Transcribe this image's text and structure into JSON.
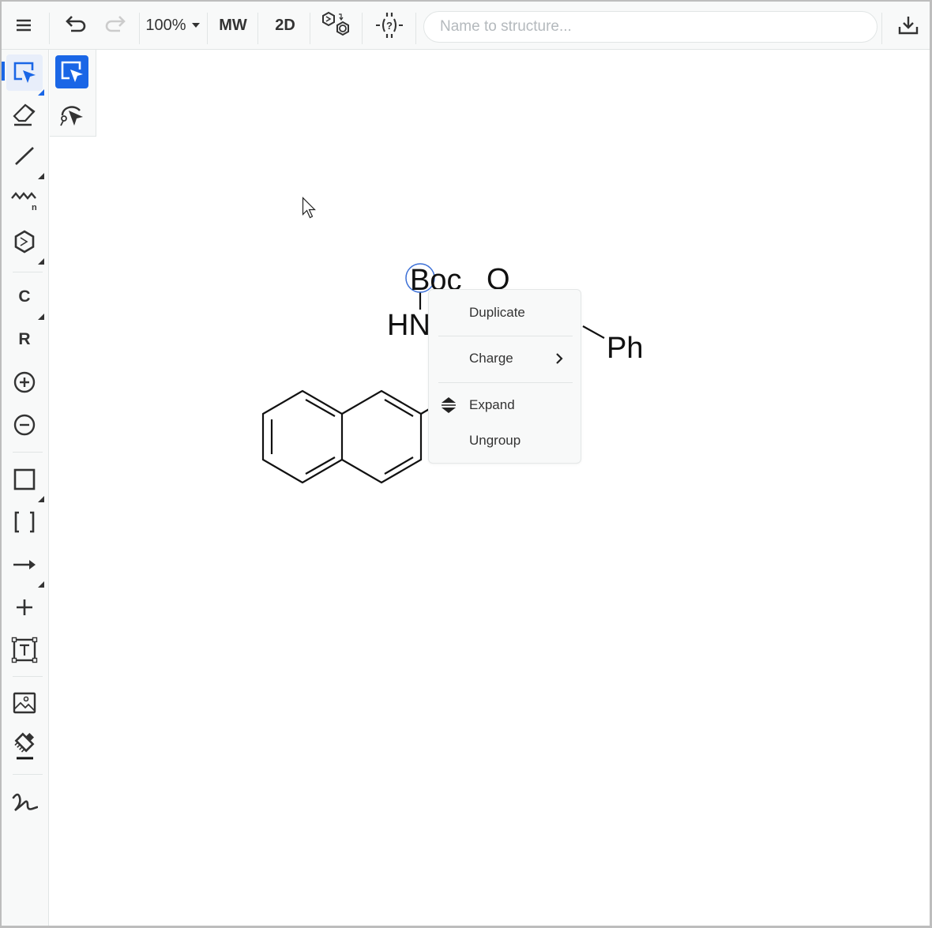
{
  "toolbar": {
    "menu_icon": "hamburger-menu-icon",
    "undo_icon": "undo-icon",
    "redo_icon": "redo-icon",
    "zoom_level": "100%",
    "mw_label": "MW",
    "dim_label": "2D",
    "aromatize_icon": "aromatize-icon",
    "query_icon": "query-features-icon",
    "search_placeholder": "Name to structure...",
    "search_value": "",
    "download_icon": "download-icon"
  },
  "left_tools": [
    {
      "name": "select",
      "icon": "selection-rectangle-icon",
      "active": true
    },
    {
      "name": "erase",
      "icon": "eraser-icon"
    },
    {
      "name": "bond",
      "icon": "single-bond-icon"
    },
    {
      "name": "chain",
      "icon": "chain-icon"
    },
    {
      "name": "template",
      "icon": "benzene-ring-icon"
    },
    {
      "name": "atom-c",
      "label": "C"
    },
    {
      "name": "rgroup",
      "label": "R"
    },
    {
      "name": "charge-plus",
      "icon": "charge-plus-icon"
    },
    {
      "name": "charge-minus",
      "icon": "charge-minus-icon"
    },
    {
      "name": "shape",
      "icon": "rectangle-icon"
    },
    {
      "name": "sgroup",
      "icon": "brackets-icon"
    },
    {
      "name": "reaction-arrow",
      "icon": "arrow-right-icon"
    },
    {
      "name": "reaction-plus",
      "icon": "plus-icon"
    },
    {
      "name": "text",
      "icon": "text-box-icon"
    },
    {
      "name": "image",
      "icon": "image-icon"
    },
    {
      "name": "clean-up",
      "icon": "paint-brush-icon"
    },
    {
      "name": "freehand",
      "icon": "freehand-icon"
    }
  ],
  "sub_tools": [
    {
      "name": "rectangle-select",
      "icon": "selection-rectangle-icon",
      "active": true
    },
    {
      "name": "lasso-select",
      "icon": "lasso-select-icon"
    }
  ],
  "molecule": {
    "labels": {
      "boc": "Boc",
      "oxygen": "O",
      "hn": "HN",
      "ph": "Ph"
    }
  },
  "context_menu": {
    "items": [
      {
        "label": "Duplicate"
      },
      {
        "label": "Charge",
        "submenu": true
      },
      {
        "label": "Expand",
        "icon": "expand-icon"
      },
      {
        "label": "Ungroup"
      }
    ]
  },
  "colors": {
    "accent": "#1a66e6",
    "toolbar_bg": "#f8f9f9",
    "border": "#e1e5e5",
    "icon": "#333333"
  }
}
